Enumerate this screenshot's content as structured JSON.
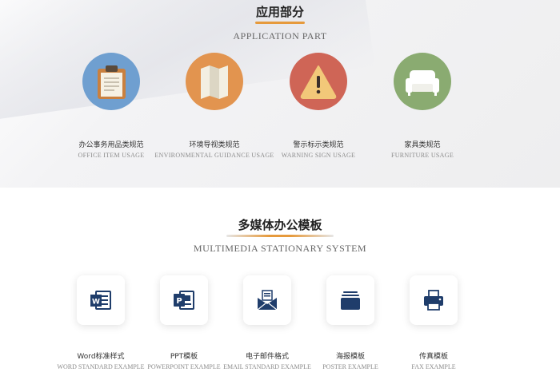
{
  "application": {
    "title": "应用部分",
    "subtitle": "APPLICATION PART",
    "items": [
      {
        "cn": "办公事务用品类规范",
        "en": "OFFICE ITEM USAGE",
        "icon": "clipboard-icon",
        "color": "#6f9fd0"
      },
      {
        "cn": "环境导视类规范",
        "en": "ENVIRONMENTAL GUIDANCE USAGE",
        "icon": "map-icon",
        "color": "#e2944f"
      },
      {
        "cn": "警示标示类规范",
        "en": "WARNING SIGN USAGE",
        "icon": "warning-icon",
        "color": "#cf6556"
      },
      {
        "cn": "家具类规范",
        "en": "FURNITURE USAGE",
        "icon": "sofa-icon",
        "color": "#8aab71"
      }
    ]
  },
  "multimedia": {
    "title": "多媒体办公模板",
    "subtitle": "MULTIMEDIA STATIONARY SYSTEM",
    "items": [
      {
        "cn": "Word标准样式",
        "en": "WORD STANDARD EXAMPLE",
        "icon": "word-icon"
      },
      {
        "cn": "PPT模板",
        "en": "POWERPOINT EXAMPLE",
        "icon": "powerpoint-icon"
      },
      {
        "cn": "电子邮件格式",
        "en": "EMAIL STANDARD EXAMPLE",
        "icon": "email-icon"
      },
      {
        "cn": "海报模板",
        "en": "POSTER EXAMPLE",
        "icon": "poster-icon"
      },
      {
        "cn": "传真模板",
        "en": "FAX EXAMPLE",
        "icon": "fax-icon"
      }
    ],
    "icon_color": "#1f3d6b"
  },
  "accent_color": "#e69a3c"
}
